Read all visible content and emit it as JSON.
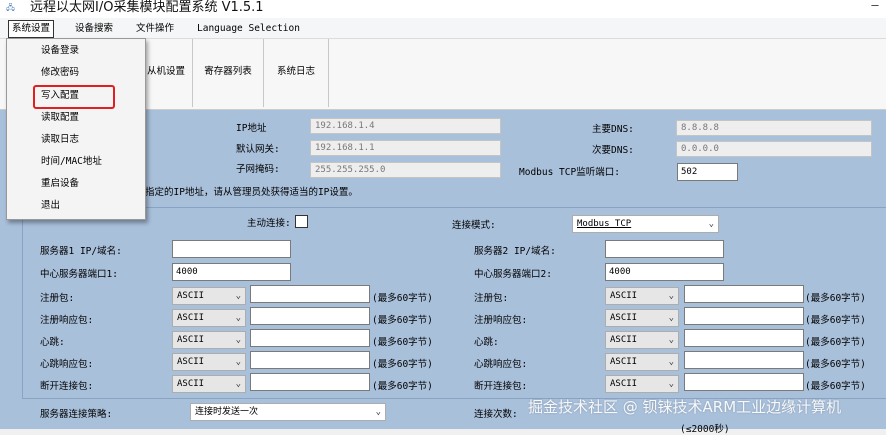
{
  "window": {
    "title": "远程以太网I/O采集模块配置系统 V1.5.1",
    "icon": "app-icon",
    "minimize": "—"
  },
  "menu": [
    "系统设置",
    "设备搜索",
    "文件操作",
    "Language Selection"
  ],
  "system_menu": {
    "items": [
      "设备登录",
      "修改密码",
      "写入配置",
      "读取配置",
      "读取日志",
      "时间/MAC地址",
      "重启设备",
      "退出"
    ],
    "highlighted": "写入配置",
    "highlight_color": "#e02020"
  },
  "toolbar": {
    "buttons": [
      "从机设置",
      "寄存器列表",
      "系统日志"
    ]
  },
  "network": {
    "ip_label": "IP地址",
    "ip_value": "192.168.1.4",
    "gateway_label": "默认网关:",
    "gateway_value": "192.168.1.1",
    "mask_label": "子网掩码:",
    "mask_value": "255.255.255.0",
    "dns1_label": "主要DNS:",
    "dns1_value": "8.8.8.8",
    "dns2_label": "次要DNS:",
    "dns2_value": "0.0.0.0",
    "port_label": "Modbus TCP监听端口:",
    "port_value": "502",
    "note": "指定的IP地址，请从管理员处获得适当的IP设置。"
  },
  "connection": {
    "active_label": "主动连接:",
    "active_checked": false,
    "mode_label": "连接模式:",
    "mode_value": "Modbus TCP"
  },
  "servers": [
    {
      "addr_label": "服务器1 IP/域名:",
      "addr_value": "",
      "port_label": "中心服务器端口1:",
      "port_value": "4000",
      "rows": [
        {
          "label": "注册包:",
          "enc": "ASCII",
          "value": "",
          "hint": "(最多60字节)"
        },
        {
          "label": "注册响应包:",
          "enc": "ASCII",
          "value": "",
          "hint": "(最多60字节)"
        },
        {
          "label": "心跳:",
          "enc": "ASCII",
          "value": "",
          "hint": "(最多60字节)"
        },
        {
          "label": "心跳响应包:",
          "enc": "ASCII",
          "value": "",
          "hint": "(最多60字节)"
        },
        {
          "label": "断开连接包:",
          "enc": "ASCII",
          "value": "",
          "hint": "(最多60字节)"
        }
      ]
    },
    {
      "addr_label": "服务器2 IP/域名:",
      "addr_value": "",
      "port_label": "中心服务器端口2:",
      "port_value": "4000",
      "rows": [
        {
          "label": "注册包:",
          "enc": "ASCII",
          "value": "",
          "hint": "(最多60字节)"
        },
        {
          "label": "注册响应包:",
          "enc": "ASCII",
          "value": "",
          "hint": "(最多60字节)"
        },
        {
          "label": "心跳:",
          "enc": "ASCII",
          "value": "",
          "hint": "(最多60字节)"
        },
        {
          "label": "心跳响应包:",
          "enc": "ASCII",
          "value": "",
          "hint": "(最多60字节)"
        },
        {
          "label": "断开连接包:",
          "enc": "ASCII",
          "value": "",
          "hint": "(最多60字节)"
        }
      ]
    }
  ],
  "policy": {
    "label": "服务器连接策略:",
    "value": "连接时发送一次",
    "count_label": "连接次数:",
    "partial_hint": "(≤2000秒)"
  },
  "watermark": "掘金技术社区 @ 钡铼技术ARM工业边缘计算机",
  "colors": {
    "panel": "#a9c0db",
    "highlight": "#e02020"
  }
}
